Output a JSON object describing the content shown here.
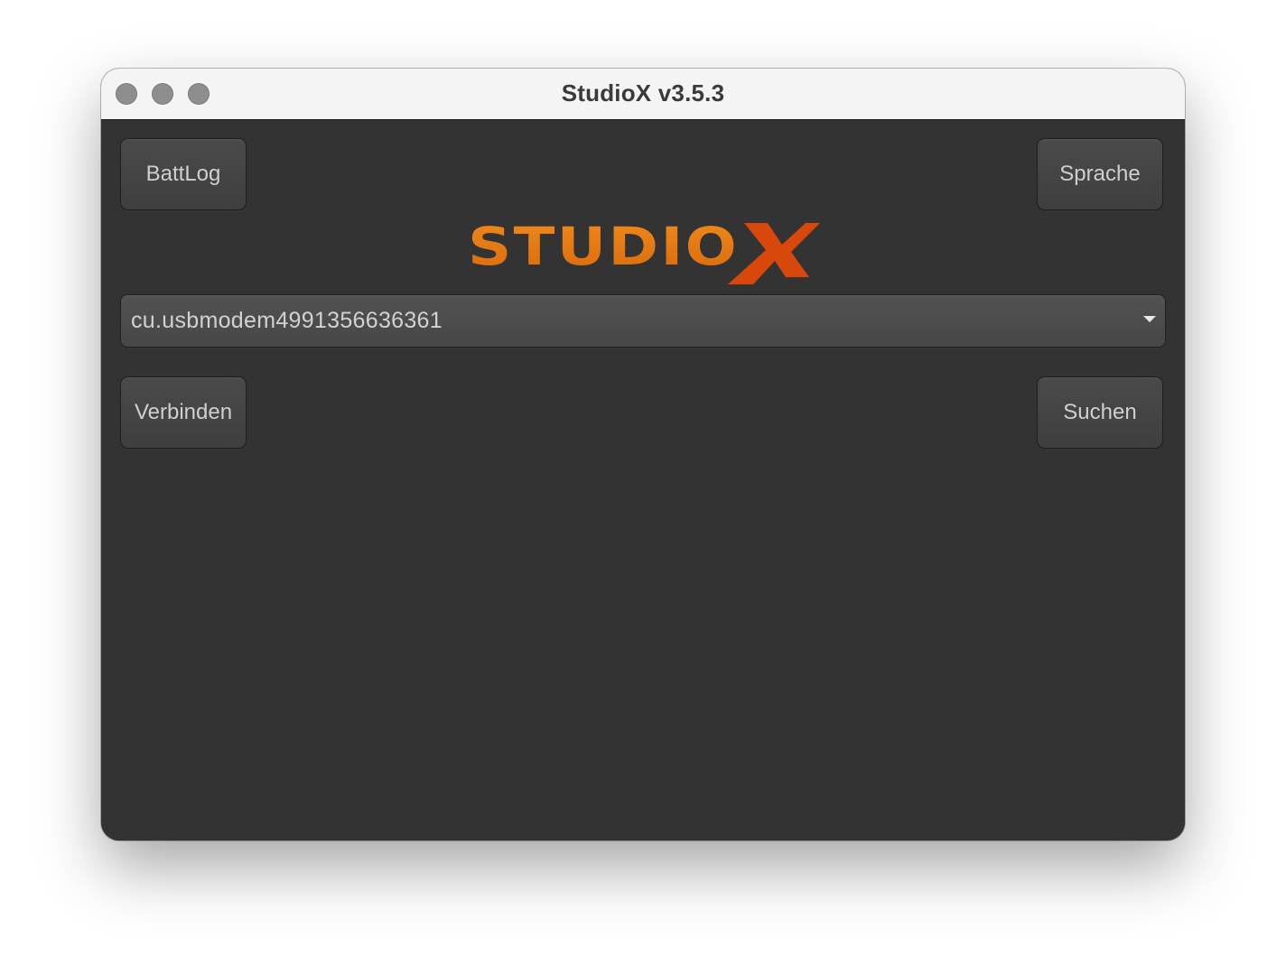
{
  "window": {
    "title": "StudioX v3.5.3"
  },
  "toolbar": {
    "battlog_label": "BattLog",
    "language_label": "Sprache"
  },
  "logo": {
    "text": "STUDIOX",
    "brand_color": "#e8740f",
    "accent_color": "#d9480b"
  },
  "port_select": {
    "selected_value": "cu.usbmodem4991356636361"
  },
  "actions": {
    "connect_label": "Verbinden",
    "search_label": "Suchen"
  }
}
